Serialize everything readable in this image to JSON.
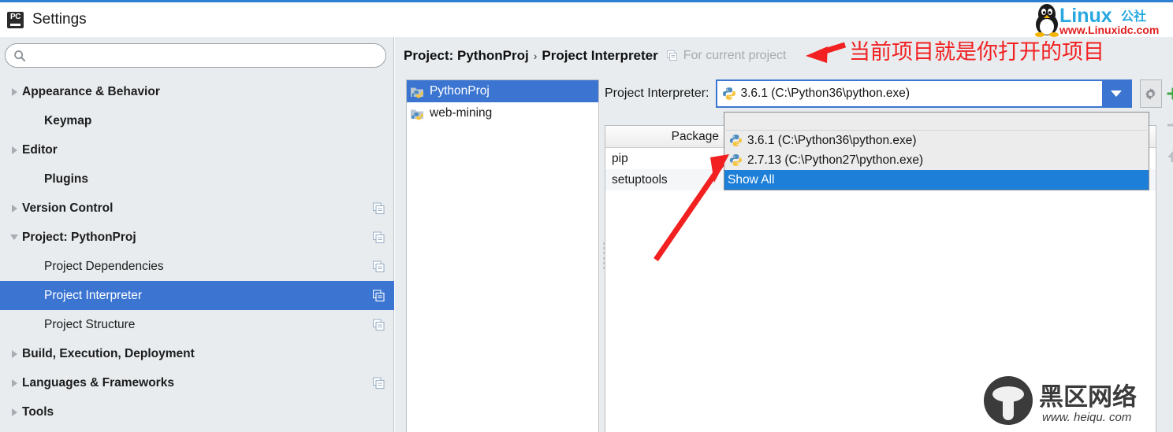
{
  "window": {
    "app_icon": "pycharm-pc-icon",
    "app_icon_text": "PC",
    "title": "Settings"
  },
  "sidebar": {
    "search": {
      "value": "",
      "placeholder": "",
      "icon": "search-icon"
    },
    "items": [
      {
        "label": "Appearance & Behavior",
        "expander": "collapsed",
        "bold": true,
        "indent": false,
        "copy_icon": false,
        "selected": false
      },
      {
        "label": "Keymap",
        "expander": "none",
        "bold": true,
        "indent": true,
        "copy_icon": false,
        "selected": false
      },
      {
        "label": "Editor",
        "expander": "collapsed",
        "bold": true,
        "indent": false,
        "copy_icon": false,
        "selected": false
      },
      {
        "label": "Plugins",
        "expander": "none",
        "bold": true,
        "indent": true,
        "copy_icon": false,
        "selected": false
      },
      {
        "label": "Version Control",
        "expander": "collapsed",
        "bold": true,
        "indent": false,
        "copy_icon": true,
        "selected": false
      },
      {
        "label": "Project: PythonProj",
        "expander": "expanded",
        "bold": true,
        "indent": false,
        "copy_icon": true,
        "selected": false
      },
      {
        "label": "Project Dependencies",
        "expander": "none",
        "bold": false,
        "indent": true,
        "copy_icon": true,
        "selected": false
      },
      {
        "label": "Project Interpreter",
        "expander": "none",
        "bold": false,
        "indent": true,
        "copy_icon": true,
        "selected": true
      },
      {
        "label": "Project Structure",
        "expander": "none",
        "bold": false,
        "indent": true,
        "copy_icon": true,
        "selected": false
      },
      {
        "label": "Build, Execution, Deployment",
        "expander": "collapsed",
        "bold": true,
        "indent": false,
        "copy_icon": false,
        "selected": false
      },
      {
        "label": "Languages & Frameworks",
        "expander": "collapsed",
        "bold": true,
        "indent": false,
        "copy_icon": true,
        "selected": false
      },
      {
        "label": "Tools",
        "expander": "collapsed",
        "bold": true,
        "indent": false,
        "copy_icon": false,
        "selected": false
      }
    ]
  },
  "main": {
    "breadcrumb": {
      "root": "Project: PythonProj",
      "separator": "›",
      "leaf": "Project Interpreter",
      "scope_icon": "copy-icon",
      "scope_note": "For current project"
    },
    "project_list": [
      {
        "label": "PythonProj",
        "icon": "python-project-folder-icon",
        "selected": true
      },
      {
        "label": "web-mining",
        "icon": "python-project-folder-icon",
        "selected": false
      }
    ],
    "interpreter": {
      "label": "Project Interpreter:",
      "selected_value": "3.6.1 (C:\\Python36\\python.exe)",
      "value_icon": "python-icon",
      "dropdown_open": true,
      "arrow_icon": "chevron-down-icon",
      "gear_icon": "gear-icon",
      "options": [
        {
          "label": "3.6.1 (C:\\Python36\\python.exe)",
          "icon": "python-icon",
          "highlighted": false
        },
        {
          "label": "2.7.13 (C:\\Python27\\python.exe)",
          "icon": "python-icon",
          "highlighted": false
        }
      ],
      "show_all_label": "Show All",
      "show_all_highlighted": true
    },
    "packages": {
      "columns": [
        "Package"
      ],
      "rows": [
        {
          "package": "pip"
        },
        {
          "package": "setuptools"
        }
      ]
    },
    "toolbar": [
      {
        "name": "add-package-button",
        "icon": "plus-icon",
        "enabled": true
      },
      {
        "name": "remove-package-button",
        "icon": "minus-icon",
        "enabled": false
      },
      {
        "name": "upgrade-package-button",
        "icon": "up-arrow-icon",
        "enabled": false
      }
    ]
  },
  "annotations": {
    "note_text": "当前项目就是你打开的项目",
    "note_color": "#f22020",
    "arrows": [
      {
        "name": "arrow-to-breadcrumb"
      },
      {
        "name": "arrow-to-interpreter-dropdown"
      }
    ]
  },
  "watermarks": {
    "top_right": {
      "brand": "Linux",
      "brand_cn": "公社",
      "url": "www.Linuxidc.com"
    },
    "bottom_right": {
      "brand_cn": "黑区网络",
      "url": "www.heiqu.com"
    }
  },
  "colors": {
    "accent_blue": "#3b75d1",
    "selection_blue": "#1d7fd8",
    "sidebar_bg": "#e8ecef",
    "annotation_red": "#f22020"
  }
}
